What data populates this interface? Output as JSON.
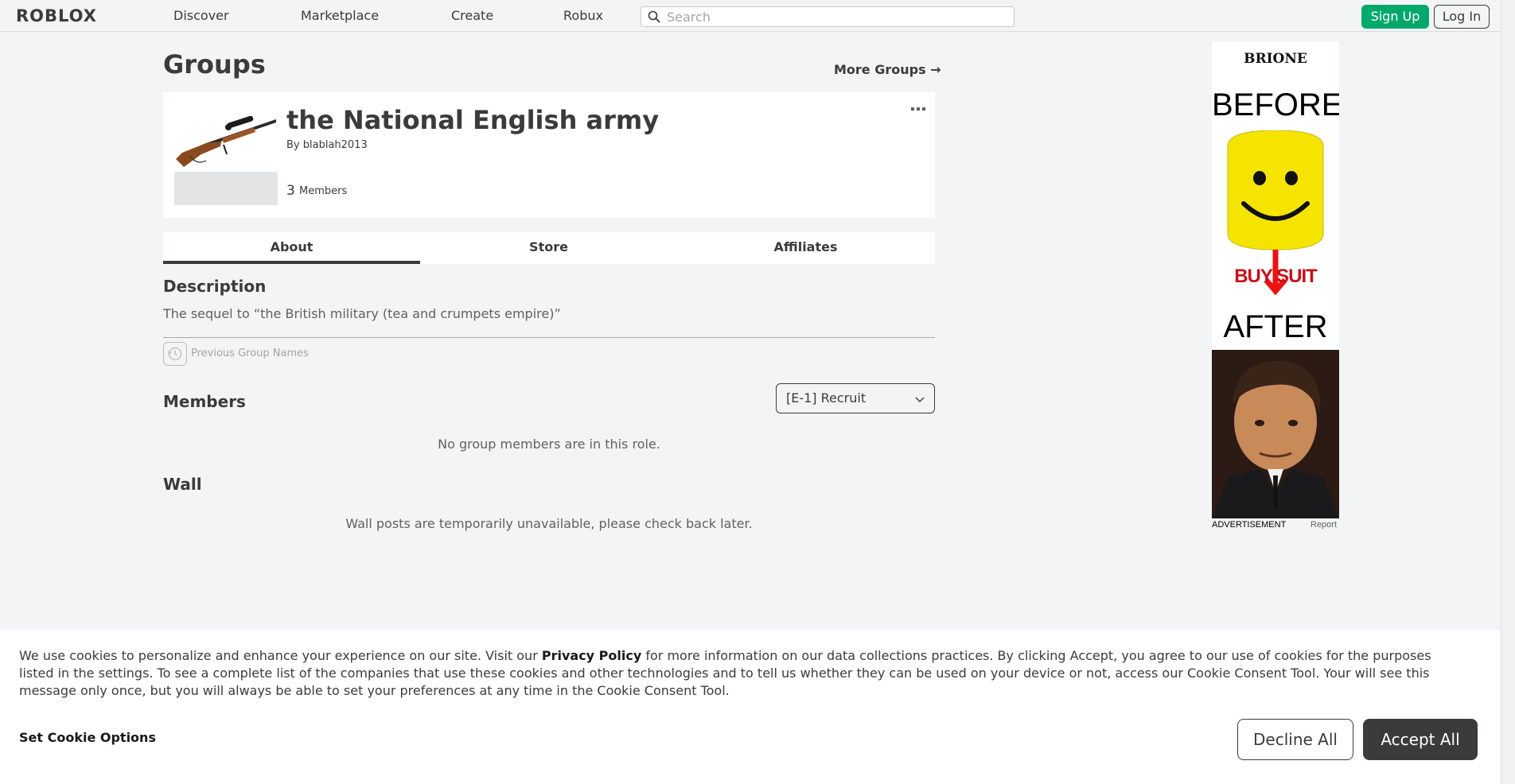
{
  "nav": {
    "logo": "ROBLOX",
    "links": [
      "Discover",
      "Marketplace",
      "Create",
      "Robux"
    ],
    "search_placeholder": "Search",
    "signup": "Sign Up",
    "login": "Log In"
  },
  "page": {
    "title": "Groups",
    "more_groups": "More Groups →"
  },
  "group": {
    "name": "the National English army",
    "owner": "By blablah2013",
    "member_count": "3",
    "member_label": "Members"
  },
  "tabs": [
    "About",
    "Store",
    "Affiliates"
  ],
  "about": {
    "description_heading": "Description",
    "description": "The sequel to “the British military (tea and crumpets empire)”",
    "previous_names": "Previous Group Names"
  },
  "members": {
    "heading": "Members",
    "role": "[E-1] Recruit",
    "empty": "No group members are in this role."
  },
  "wall": {
    "heading": "Wall",
    "message": "Wall posts are temporarily unavailable, please check back later."
  },
  "ad": {
    "brand": "BRIONE",
    "before": "BEFORE",
    "buy_suit": "BUY SUIT",
    "after": "AFTER",
    "label": "ADVERTISEMENT",
    "report": "Report"
  },
  "cookie": {
    "text_before": "We use cookies to personalize and enhance your experience on our site. Visit our ",
    "privacy_link": "Privacy Policy",
    "text_after": " for more information on our data collections practices. By clicking Accept, you agree to our use of cookies for the purposes listed in the settings. To see a complete list of the companies that use these cookies and other technologies and to tell us whether they can be used on your device or not, access our Cookie Consent Tool. Your will see this message only once, but you will always be able to set your preferences at any time in the Cookie Consent Tool.",
    "set_options": "Set Cookie Options",
    "decline": "Decline All",
    "accept": "Accept All"
  },
  "colors": {
    "signup_green": "#00a86b",
    "text_dark": "#393b3d",
    "page_bg": "#f2f4f5",
    "ad_red": "#c8101a"
  }
}
